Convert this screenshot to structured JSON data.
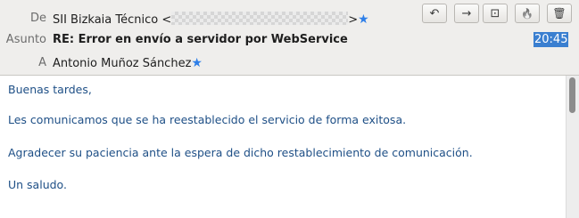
{
  "header": {
    "from_label": "De",
    "from_name": "SII Bizkaia Técnico",
    "from_open": "<",
    "from_close": ">",
    "subject_label": "Asunto",
    "subject": "RE: Error en envío a servidor por WebService",
    "to_label": "A",
    "to_name": "Antonio Muñoz Sánchez",
    "star_glyph": "★",
    "time": "20:45"
  },
  "toolbar": {
    "reply_glyph": "↶",
    "forward_glyph": "→",
    "archive_glyph": "⊡",
    "junk_glyph": "🔥",
    "delete_glyph": "🗑"
  },
  "body": {
    "greeting": "Buenas tardes,",
    "line1": "Les comunicamos que se ha reestablecido el servicio de forma exitosa.",
    "line2": "Agradecer su paciencia ante la espera de dicho restablecimiento de comunicación.",
    "closing": "Un saludo."
  },
  "colors": {
    "header_bg": "#efeeec",
    "body_text": "#1e4f86",
    "star": "#2e7fe8",
    "time_highlight": "#3a7fd0"
  }
}
